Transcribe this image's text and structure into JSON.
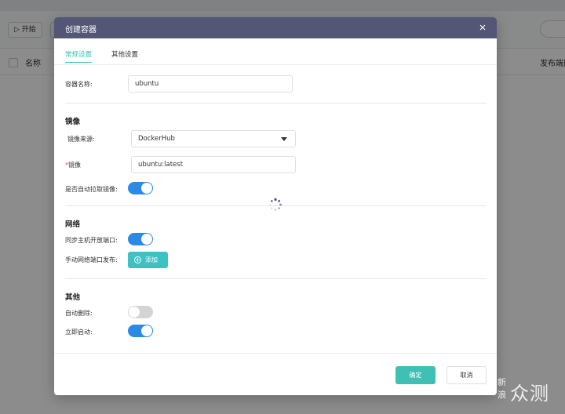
{
  "background": {
    "toolbar": {
      "start_label": "▷ 开始"
    },
    "table": {
      "col_name": "名称",
      "col_ports": "发布端口"
    }
  },
  "dialog": {
    "title": "创建容器",
    "tabs": [
      {
        "label": "常规设置",
        "active": true
      },
      {
        "label": "其他设置",
        "active": false
      }
    ],
    "container_name": {
      "label": "容器名称:",
      "value": "ubuntu"
    },
    "image_section": {
      "title": "镜像",
      "source": {
        "label": "镜像来源:",
        "value": "DockerHub"
      },
      "image": {
        "required_mark": "*",
        "label": "镜像",
        "value": "ubuntu:latest"
      },
      "auto_pull": {
        "label": "是否自动拉取镜像:",
        "on": true
      }
    },
    "network_section": {
      "title": "网络",
      "sync_ports": {
        "label": "同步主机开放端口:",
        "on": true
      },
      "manual_ports": {
        "label": "手动网络端口发布:",
        "add_label": "添加"
      }
    },
    "other_section": {
      "title": "其他",
      "auto_remove": {
        "label": "自动删除:",
        "on": false
      },
      "start_now": {
        "label": "立即启动:",
        "on": true
      }
    },
    "footer": {
      "confirm_label": "确定",
      "cancel_label": "取消"
    }
  },
  "watermark": {
    "small": "新浪",
    "big": "众测"
  },
  "colors": {
    "accent": "#3ec1b4",
    "toggle_on": "#2b8ae2",
    "header": "#535675"
  }
}
